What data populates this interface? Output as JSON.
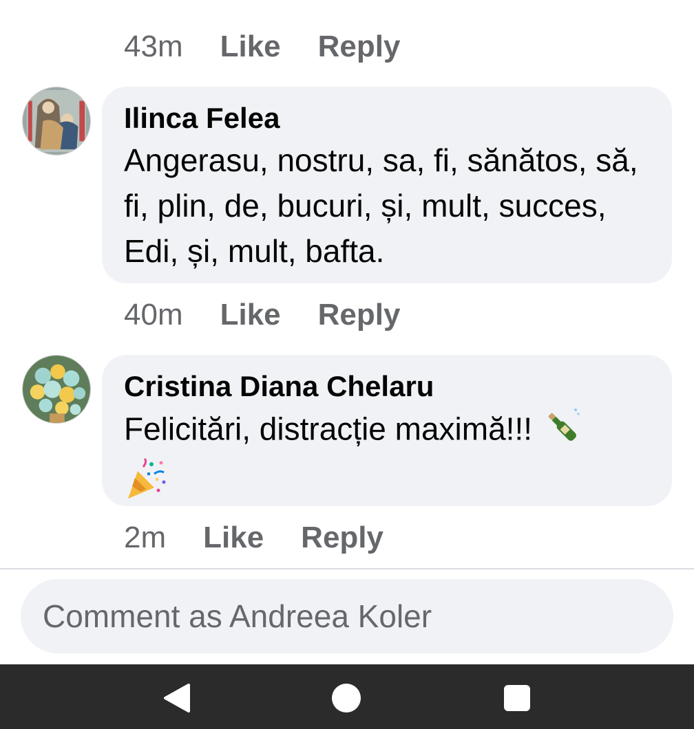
{
  "comments": [
    {
      "time": "43m",
      "like_label": "Like",
      "reply_label": "Reply"
    },
    {
      "author": "Ilinca Felea",
      "text": "Angerasu, nostru, sa, fi, sănătos, să, fi, plin, de, bucuri, și, mult, succes, Edi, și, mult, bafta.",
      "time": "40m",
      "like_label": "Like",
      "reply_label": "Reply",
      "avatar_icon": "religious-icon-avatar"
    },
    {
      "author": "Cristina Diana Chelaru",
      "text": "Felicitări, distracție maximă!!!",
      "emojis": [
        "bottle-with-popping-cork-icon",
        "party-popper-icon"
      ],
      "time": "2m",
      "like_label": "Like",
      "reply_label": "Reply",
      "avatar_icon": "flower-bouquet-avatar"
    }
  ],
  "composer": {
    "placeholder": "Comment as Andreea Koler"
  },
  "navbar": {
    "icons": [
      "back-icon",
      "home-icon",
      "recents-icon"
    ]
  },
  "colors": {
    "bubble": "#f0f2f5",
    "meta_text": "#65676b",
    "body_text": "#050505",
    "navbar": "#2b2b2b"
  }
}
